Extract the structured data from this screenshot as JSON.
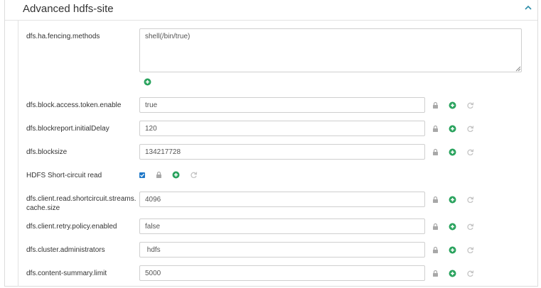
{
  "section": {
    "title": "Advanced hdfs-site"
  },
  "fields": [
    {
      "label": "dfs.ha.fencing.methods",
      "value": "shell(/bin/true)"
    },
    {
      "label": "dfs.block.access.token.enable",
      "value": "true"
    },
    {
      "label": "dfs.blockreport.initialDelay",
      "value": "120"
    },
    {
      "label": "dfs.blocksize",
      "value": "134217728"
    },
    {
      "label": "HDFS Short-circuit read",
      "checked": true
    },
    {
      "label_line1": "dfs.client.read.shortcircuit.streams.",
      "label_line2": "cache.size",
      "value": "4096"
    },
    {
      "label": "dfs.client.retry.policy.enabled",
      "value": "false"
    },
    {
      "label": "dfs.cluster.administrators",
      "value": " hdfs"
    },
    {
      "label": "dfs.content-summary.limit",
      "value": "5000"
    }
  ],
  "colors": {
    "add_green": "#2aa35e",
    "lock_gray": "#a8a8a8",
    "undo_gray": "#c2c2c2",
    "checkbox_blue": "#1f78c8",
    "collapse_teal": "#2c8ca8"
  },
  "icons": {
    "collapse": "chevron-up-icon",
    "add": "plus-circle-icon",
    "lock": "lock-icon",
    "undo": "undo-icon"
  }
}
